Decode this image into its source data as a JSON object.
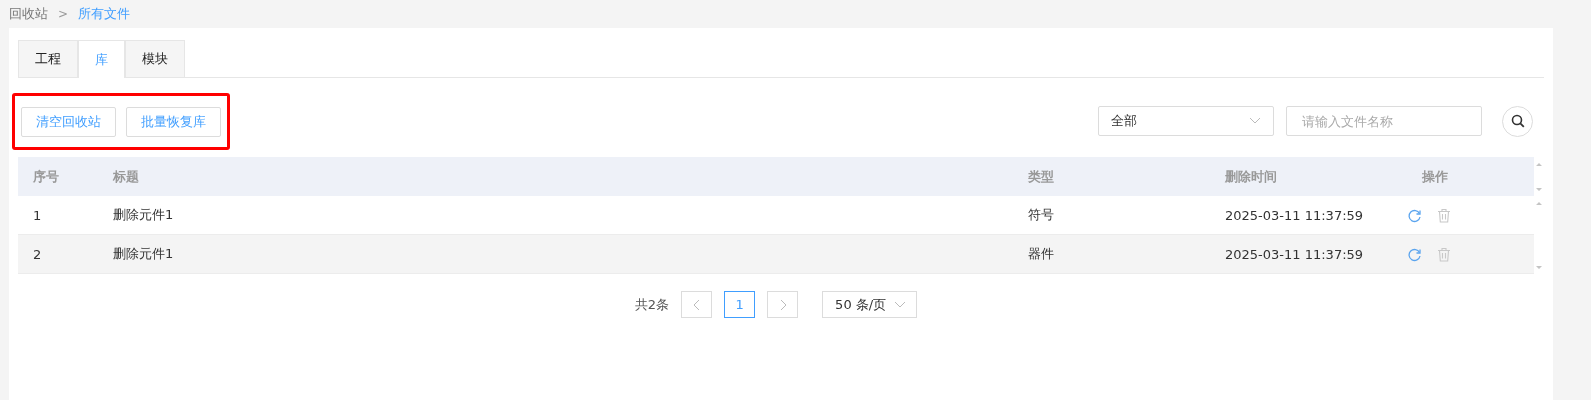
{
  "breadcrumb": [
    {
      "label": "回收站",
      "current": false
    },
    {
      "label": "所有文件",
      "current": true
    }
  ],
  "breadcrumb_separator": ">",
  "tabs": [
    {
      "label": "工程",
      "selected": false
    },
    {
      "label": "库",
      "selected": true
    },
    {
      "label": "模块",
      "selected": false
    }
  ],
  "buttons": [
    "清空回收站",
    "批量恢复库"
  ],
  "filter": {
    "value": "全部"
  },
  "search": {
    "placeholder": "请输入文件名称"
  },
  "table": {
    "columns": [
      "序号",
      "标题",
      "类型",
      "删除时间",
      "操作"
    ],
    "rows": [
      {
        "index": "1",
        "title": "删除元件1",
        "type": "符号",
        "deleted_at": "2025-03-11 11:37:59"
      },
      {
        "index": "2",
        "title": "删除元件1",
        "type": "器件",
        "deleted_at": "2025-03-11 11:37:59"
      }
    ]
  },
  "pagination": {
    "total": "共2条",
    "pages": [
      {
        "label": "1",
        "selected": true
      }
    ],
    "page_size": "50 条/页"
  }
}
